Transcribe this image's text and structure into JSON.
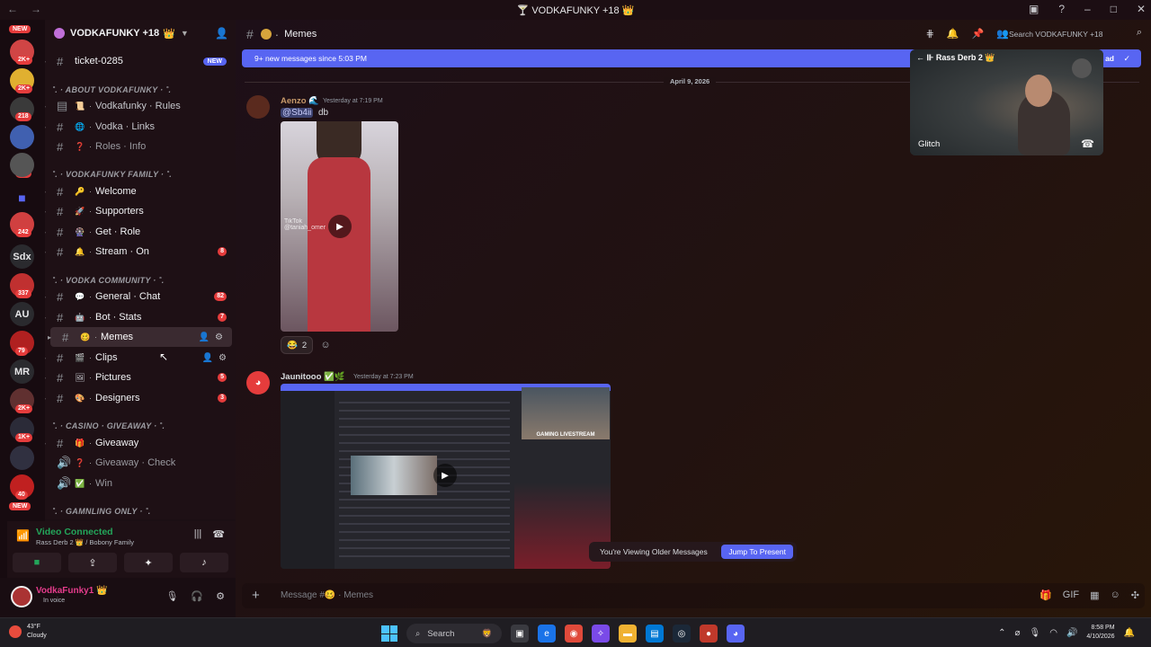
{
  "window": {
    "title": "VODKAFUNKY +18"
  },
  "servers": [
    {
      "label": "",
      "badge": "",
      "color": "#d04545",
      "y": 26
    },
    {
      "label": "",
      "badge": "2K+",
      "color": "#c8a040"
    },
    {
      "label": "",
      "badge": "2K+",
      "color": "#e0b030"
    },
    {
      "label": "",
      "badge": "218",
      "color": "#3a3a3a"
    },
    {
      "label": "",
      "badge": "139",
      "color": "#4060b0"
    },
    {
      "label": "",
      "badge": "",
      "color": "#5865f2"
    },
    {
      "label": "",
      "badge": "242",
      "color": "#d04040"
    },
    {
      "label": "Sdx",
      "badge": "",
      "color": "#2a2a2e"
    },
    {
      "label": "",
      "badge": "337",
      "color": "#c03030"
    },
    {
      "label": "AU",
      "badge": "",
      "color": "#2a2a2e"
    },
    {
      "label": "",
      "badge": "79",
      "color": "#b02020"
    },
    {
      "label": "MR",
      "badge": "",
      "color": "#2a2a2e"
    },
    {
      "label": "",
      "badge": "2K+",
      "color": "#603030"
    },
    {
      "label": "",
      "badge": "1K+",
      "color": "#2b2b38"
    },
    {
      "label": "",
      "badge": "",
      "color": "#303040"
    },
    {
      "label": "",
      "badge": "40",
      "color": "#c02020"
    }
  ],
  "server_new_labels": [
    "NEW",
    "NEW"
  ],
  "guild": {
    "name": "VODKAFUNKY +18",
    "crown": "👑"
  },
  "channels": {
    "ticket": {
      "name": "ticket-0285",
      "badge": "NEW"
    },
    "cat1": {
      "name": "˚. · ABOUT VODKAFUNKY · ˚."
    },
    "rules": {
      "name": "Vodkafunky · Rules",
      "emoji": "📜"
    },
    "links": {
      "name": "Vodka · Links",
      "emoji": "🌐"
    },
    "roles": {
      "name": "Roles · Info",
      "emoji": "❓"
    },
    "cat2": {
      "name": "˚. · VODKAFUNKY FAMILY · ˚."
    },
    "welcome": {
      "name": "Welcome",
      "emoji": "🔑"
    },
    "supporters": {
      "name": "Supporters",
      "emoji": "🚀"
    },
    "getrole": {
      "name": "Get · Role",
      "emoji": "🎡"
    },
    "stream": {
      "name": "Stream · On",
      "emoji": "🔔",
      "badge": "8"
    },
    "cat3": {
      "name": "˚. · VODKA COMMUNITY · ˚."
    },
    "general": {
      "name": "General · Chat",
      "emoji": "💬",
      "badge": "82"
    },
    "botstats": {
      "name": "Bot · Stats",
      "emoji": "🤖",
      "badge": "7"
    },
    "memes": {
      "name": "Memes",
      "emoji": "🥴"
    },
    "clips": {
      "name": "Clips",
      "emoji": "🎬"
    },
    "pictures": {
      "name": "Pictures",
      "emoji": "🖼",
      "badge": "5"
    },
    "designers": {
      "name": "Designers",
      "emoji": "🎨",
      "badge": "3"
    },
    "cat4": {
      "name": "˚. · CASINO · GIVEAWAY · ˚."
    },
    "giveaway": {
      "name": "Giveaway",
      "emoji": "🎁"
    },
    "givecheck": {
      "name": "Giveaway · Check",
      "emoji": "❓"
    },
    "win": {
      "name": "Win",
      "emoji": "✅"
    },
    "cat5": {
      "name": "˚. · GAMNLING ONLY · ˚."
    }
  },
  "voice": {
    "status": "Video Connected",
    "sub": "Rass Derb 2 👑 / Bobony Family"
  },
  "user": {
    "name": "VodkaFunky1",
    "status": "In voice"
  },
  "header": {
    "channel": "Memes",
    "search_placeholder": "Search VODKAFUNKY +18"
  },
  "newbar": {
    "text": "9+ new messages since 5:03 PM",
    "mark_read": "ad"
  },
  "date_divider": "April 9, 2026",
  "pip": {
    "name": "Rass Derb 2",
    "game": "Glitch"
  },
  "messages": [
    {
      "author": "Aenzo",
      "time": "Yesterday at 7:19 PM",
      "mention": "@Sb4ii",
      "text": "db",
      "reaction_count": "2",
      "tiktok": "TikTok",
      "tiktok_user": "@taniah_omer"
    },
    {
      "author": "Jaunitooo",
      "time": "Yesterday at 7:23 PM",
      "cam_text": "GAMING LIVESTREAM"
    }
  ],
  "older": {
    "text": "You're Viewing Older Messages",
    "jump": "Jump To Present"
  },
  "composer": {
    "placeholder": "Message #🥴 · Memes"
  },
  "taskbar": {
    "temp": "43°F",
    "weather": "Cloudy",
    "search": "Search",
    "time": "8:58 PM",
    "date": "4/10/2026"
  },
  "colors": {
    "accent": "#5865f2",
    "badge": "#e53c3c",
    "green": "#23a55a",
    "username": "#e53c8c"
  }
}
